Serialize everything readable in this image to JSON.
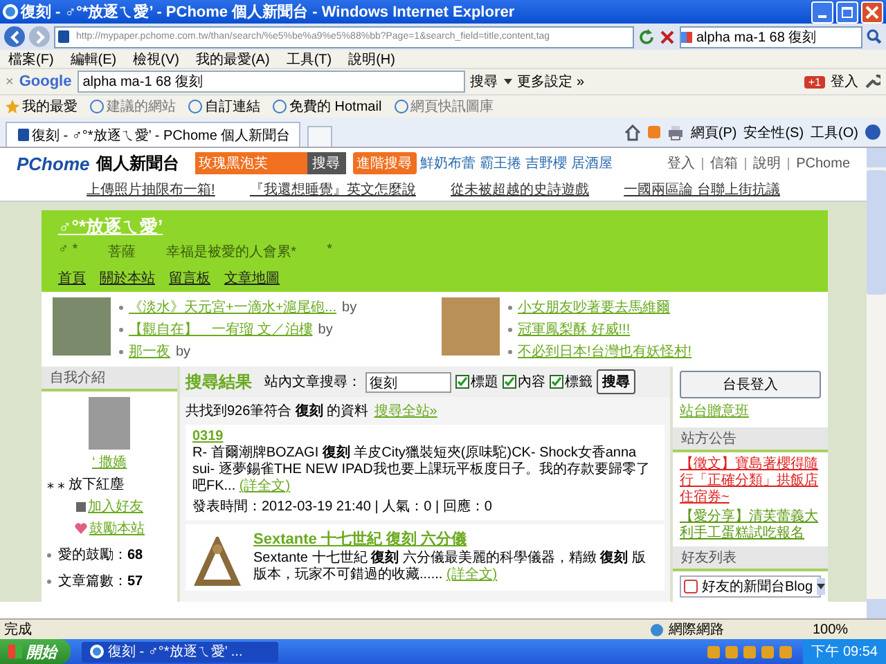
{
  "window": {
    "title": "復刻 - ♂°*放逐ㄟ愛’ - PChome 個人新聞台 - Windows Internet Explorer"
  },
  "address_bar": {
    "url": "http://mypaper.pchome.com.tw/than/search/%e5%be%a9%e5%88%bb?Page=1&search_field=title,content,tag",
    "search_value": "alpha ma-1 68 復刻"
  },
  "menu_bar": [
    "檔案(F)",
    "編輯(E)",
    "檢視(V)",
    "我的最愛(A)",
    "工具(T)",
    "說明(H)"
  ],
  "google_toolbar": {
    "close": "×",
    "logo": "Google",
    "search_value": "alpha ma-1 68 復刻",
    "search_button": "搜尋",
    "more": "更多設定 »",
    "plus_one": "+1",
    "sign_in": "登入"
  },
  "favorites_bar": {
    "label": "我的最愛",
    "links": [
      "建議的網站",
      "自訂連結",
      "免費的 Hotmail",
      "網頁快訊圖庫"
    ]
  },
  "tabs": [
    {
      "label": "復刻 - ♂°*放逐ㄟ愛’ - PChome 個人新聞台",
      "selected": true
    }
  ],
  "command_bar": [
    "網頁(P)",
    "安全性(S)",
    "工具(O)"
  ],
  "site_header": {
    "logo": "PChome",
    "site_name": "個人新聞台",
    "search_value": "玫瑰黑泡芙",
    "search_button": "搜尋",
    "advanced_search": "進階搜尋",
    "hot_keywords": [
      "鮮奶布蕾",
      "霸王捲",
      "吉野櫻",
      "居酒屋"
    ],
    "account_links": [
      "登入",
      "信箱",
      "說明",
      "PChome"
    ],
    "promo_links": [
      "上傳照片抽限布一箱!",
      "『我還想睡覺』英文怎麼說",
      "從未被超越的史詩遊戲",
      "一國兩區論 台聯上街抗議"
    ]
  },
  "blog": {
    "title": "♂°*放逐ㄟ愛’",
    "tagline": [
      "♂ *",
      "菩薩",
      "幸福是被愛的人會累*",
      "*"
    ],
    "nav": [
      "首頁",
      "關於本站",
      "留言板",
      "文章地圖"
    ]
  },
  "featured": [
    {
      "links": [
        {
          "text": "《淡水》天元宮+一滴水+滬尾砲...",
          "by": "by"
        },
        {
          "text": "【觀自在】　一宥瑠 文／泊樓",
          "by": "by"
        },
        {
          "text": "那一夜",
          "by": "by"
        }
      ]
    },
    {
      "links": [
        {
          "text": "小女朋友吵著要去馬維爾"
        },
        {
          "text": "冠軍鳳梨酥 好威!!!"
        },
        {
          "text": "不必到日本!台灣也有妖怪村!"
        }
      ]
    }
  ],
  "profile": {
    "heading": "自我介紹",
    "name": "‘ 撒嬌",
    "motto": "⁎ ⁎ 放下紅塵",
    "add_friend": "加入好友",
    "encourage": "鼓勵本站",
    "stats": [
      "愛的鼓勵：**68**",
      "文章篇數：**57**"
    ]
  },
  "search_results": {
    "heading": "搜尋結果",
    "search_label": "站內文章搜尋：",
    "search_value": "復刻",
    "options": [
      {
        "label": "標題",
        "checked": true
      },
      {
        "label": "內容",
        "checked": true
      },
      {
        "label": "標籤",
        "checked": true
      }
    ],
    "search_button": "搜尋",
    "summary": "共找到926筆符合 **復刻** 的資料",
    "search_all": "搜尋全站»",
    "posts": [
      {
        "kind": "text",
        "title": "0319",
        "excerpt": "R- 首爾潮牌BOZAGI **復刻** 羊皮City獵裝短夾(原味駝)CK- Shock女香anna sui- 逐夢錫雀THE NEW IPAD我也要上課玩平板度日子。我的存款要歸零了吧FK...",
        "more": "(詳全文)",
        "meta": "發表時間：2012-03-19 21:40 | 人氣：0 | 回應：0"
      },
      {
        "kind": "image",
        "title": "Sextante 十七世紀 **復刻** 六分儀",
        "excerpt": "Sextante 十七世紀 **復刻** 六分儀最美麗的科學儀器，精緻 **復刻** 版版本，玩家不可錯過的收藏......",
        "more": "(詳全文)"
      }
    ]
  },
  "right_panel": {
    "login_button": "台長登入",
    "link": "站台贈意班",
    "announcements_heading": "站方公告",
    "announcements": [
      {
        "text": "【徵文】寶島著櫻得隨行「正確分類」拱飯店住宿券~",
        "color": "#e02020"
      },
      {
        "text": "【愛分享】清芙蕾義大利手工蛋糕試吃報名",
        "color": "#5a9a10"
      }
    ],
    "friends_heading": "好友列表",
    "friends_select": "好友的新聞台Blog"
  },
  "status_bar": {
    "text": "完成",
    "zone": "網際網路",
    "zoom": "100%"
  },
  "taskbar": {
    "start": "開始",
    "task": "復刻 - ♂°*放逐ㄟ愛’ ...",
    "clock": "下午 09:54"
  }
}
